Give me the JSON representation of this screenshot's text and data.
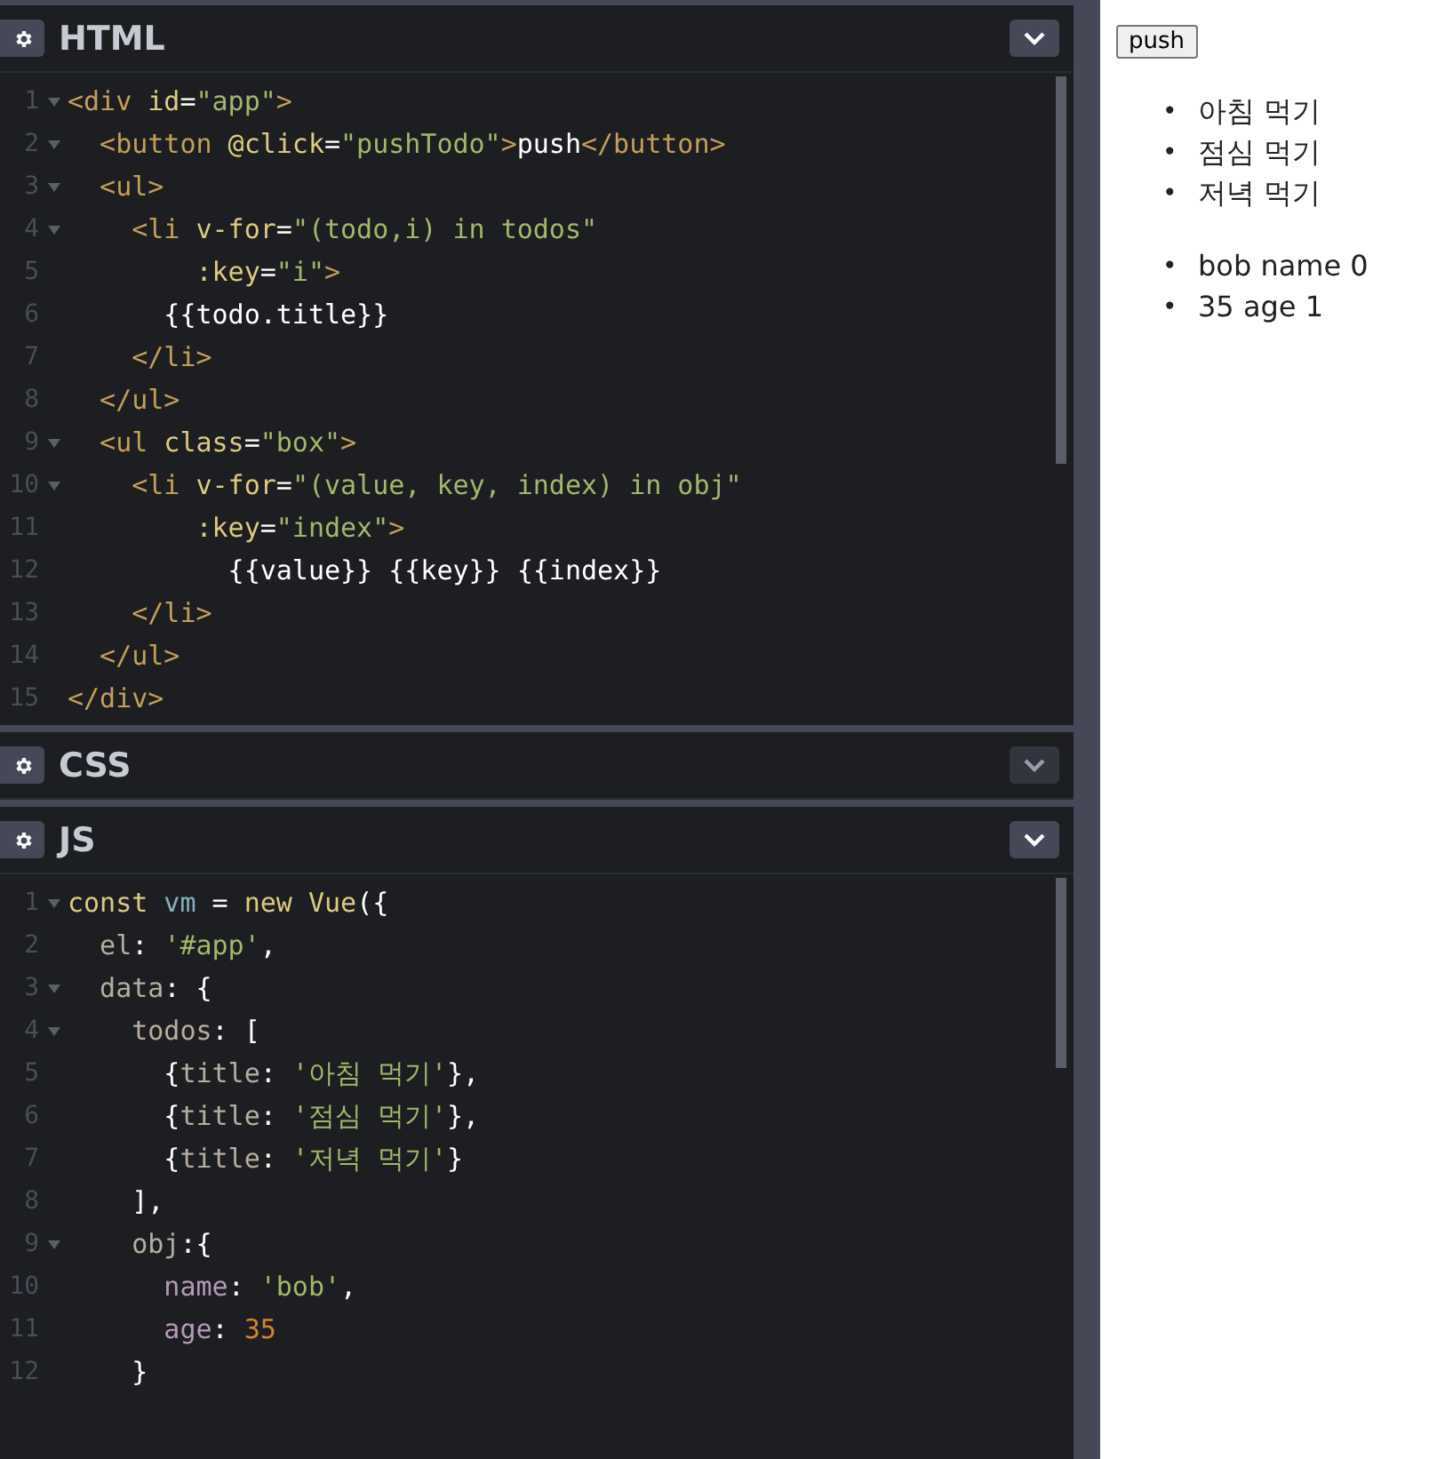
{
  "panels": [
    {
      "title": "HTML",
      "expanded": true,
      "lines": [
        {
          "number": "1",
          "foldable": true,
          "tokens": [
            {
              "kind": "tag",
              "text": "<div"
            },
            {
              "kind": "attr",
              "text": " id"
            },
            {
              "kind": "plain",
              "text": "="
            },
            {
              "kind": "string",
              "text": "\"app\""
            },
            {
              "kind": "tag",
              "text": ">"
            }
          ]
        },
        {
          "number": "2",
          "foldable": true,
          "tokens": [
            {
              "kind": "tag",
              "text": "  <button"
            },
            {
              "kind": "attr",
              "text": " @click"
            },
            {
              "kind": "plain",
              "text": "="
            },
            {
              "kind": "string",
              "text": "\"pushTodo\""
            },
            {
              "kind": "tag",
              "text": ">"
            },
            {
              "kind": "plain",
              "text": "push"
            },
            {
              "kind": "tag",
              "text": "</button>"
            }
          ]
        },
        {
          "number": "3",
          "foldable": true,
          "tokens": [
            {
              "kind": "tag",
              "text": "  <ul>"
            }
          ]
        },
        {
          "number": "4",
          "foldable": true,
          "tokens": [
            {
              "kind": "tag",
              "text": "    <li"
            },
            {
              "kind": "attr",
              "text": " v-for"
            },
            {
              "kind": "plain",
              "text": "="
            },
            {
              "kind": "string",
              "text": "\"(todo,i) in todos\""
            }
          ]
        },
        {
          "number": "5",
          "foldable": false,
          "tokens": [
            {
              "kind": "attr",
              "text": "        :key"
            },
            {
              "kind": "plain",
              "text": "="
            },
            {
              "kind": "string",
              "text": "\"i\""
            },
            {
              "kind": "tag",
              "text": ">"
            }
          ]
        },
        {
          "number": "6",
          "foldable": false,
          "tokens": [
            {
              "kind": "plain",
              "text": "      {{todo.title}}"
            }
          ]
        },
        {
          "number": "7",
          "foldable": false,
          "tokens": [
            {
              "kind": "tag",
              "text": "    </li>"
            }
          ]
        },
        {
          "number": "8",
          "foldable": false,
          "tokens": [
            {
              "kind": "tag",
              "text": "  </ul>"
            }
          ]
        },
        {
          "number": "9",
          "foldable": true,
          "tokens": [
            {
              "kind": "tag",
              "text": "  <ul"
            },
            {
              "kind": "attr",
              "text": " class"
            },
            {
              "kind": "plain",
              "text": "="
            },
            {
              "kind": "string",
              "text": "\"box\""
            },
            {
              "kind": "tag",
              "text": ">"
            }
          ]
        },
        {
          "number": "10",
          "foldable": true,
          "tokens": [
            {
              "kind": "tag",
              "text": "    <li"
            },
            {
              "kind": "attr",
              "text": " v-for"
            },
            {
              "kind": "plain",
              "text": "="
            },
            {
              "kind": "string",
              "text": "\"(value, key, index) in obj\""
            }
          ]
        },
        {
          "number": "11",
          "foldable": false,
          "tokens": [
            {
              "kind": "attr",
              "text": "        :key"
            },
            {
              "kind": "plain",
              "text": "="
            },
            {
              "kind": "string",
              "text": "\"index\""
            },
            {
              "kind": "tag",
              "text": ">"
            }
          ]
        },
        {
          "number": "12",
          "foldable": false,
          "tokens": [
            {
              "kind": "plain",
              "text": "          {{value}} {{key}} {{index}}"
            }
          ]
        },
        {
          "number": "13",
          "foldable": false,
          "tokens": [
            {
              "kind": "tag",
              "text": "    </li>"
            }
          ]
        },
        {
          "number": "14",
          "foldable": false,
          "tokens": [
            {
              "kind": "tag",
              "text": "  </ul>"
            }
          ]
        },
        {
          "number": "15",
          "foldable": false,
          "tokens": [
            {
              "kind": "tag",
              "text": "</div>"
            }
          ]
        }
      ]
    },
    {
      "title": "CSS",
      "expanded": false
    },
    {
      "title": "JS",
      "expanded": true,
      "lines": [
        {
          "number": "1",
          "foldable": true,
          "tokens": [
            {
              "kind": "keyword",
              "text": "const"
            },
            {
              "kind": "variable",
              "text": " vm"
            },
            {
              "kind": "plain",
              "text": " = "
            },
            {
              "kind": "keyword",
              "text": "new"
            },
            {
              "kind": "keyword",
              "text": " Vue"
            },
            {
              "kind": "plain",
              "text": "({"
            }
          ]
        },
        {
          "number": "2",
          "foldable": false,
          "tokens": [
            {
              "kind": "property",
              "text": "  el"
            },
            {
              "kind": "plain",
              "text": ": "
            },
            {
              "kind": "string",
              "text": "'#app'"
            },
            {
              "kind": "plain",
              "text": ","
            }
          ]
        },
        {
          "number": "3",
          "foldable": true,
          "tokens": [
            {
              "kind": "property",
              "text": "  data"
            },
            {
              "kind": "plain",
              "text": ": {"
            }
          ]
        },
        {
          "number": "4",
          "foldable": true,
          "tokens": [
            {
              "kind": "property",
              "text": "    todos"
            },
            {
              "kind": "plain",
              "text": ": ["
            }
          ]
        },
        {
          "number": "5",
          "foldable": false,
          "tokens": [
            {
              "kind": "plain",
              "text": "      {"
            },
            {
              "kind": "property",
              "text": "title"
            },
            {
              "kind": "plain",
              "text": ": "
            },
            {
              "kind": "string",
              "text": "'아침 먹기'"
            },
            {
              "kind": "plain",
              "text": "},"
            }
          ]
        },
        {
          "number": "6",
          "foldable": false,
          "tokens": [
            {
              "kind": "plain",
              "text": "      {"
            },
            {
              "kind": "property",
              "text": "title"
            },
            {
              "kind": "plain",
              "text": ": "
            },
            {
              "kind": "string",
              "text": "'점심 먹기'"
            },
            {
              "kind": "plain",
              "text": "},"
            }
          ]
        },
        {
          "number": "7",
          "foldable": false,
          "tokens": [
            {
              "kind": "plain",
              "text": "      {"
            },
            {
              "kind": "property",
              "text": "title"
            },
            {
              "kind": "plain",
              "text": ": "
            },
            {
              "kind": "string",
              "text": "'저녁 먹기'"
            },
            {
              "kind": "plain",
              "text": "}"
            }
          ]
        },
        {
          "number": "8",
          "foldable": false,
          "tokens": [
            {
              "kind": "plain",
              "text": "    ],"
            }
          ]
        },
        {
          "number": "9",
          "foldable": true,
          "tokens": [
            {
              "kind": "property",
              "text": "    obj"
            },
            {
              "kind": "plain",
              "text": ":{"
            }
          ]
        },
        {
          "number": "10",
          "foldable": false,
          "tokens": [
            {
              "kind": "key",
              "text": "      name"
            },
            {
              "kind": "plain",
              "text": ": "
            },
            {
              "kind": "string",
              "text": "'bob'"
            },
            {
              "kind": "plain",
              "text": ","
            }
          ]
        },
        {
          "number": "11",
          "foldable": false,
          "tokens": [
            {
              "kind": "key",
              "text": "      age"
            },
            {
              "kind": "plain",
              "text": ": "
            },
            {
              "kind": "number",
              "text": "35"
            }
          ]
        },
        {
          "number": "12",
          "foldable": false,
          "tokens": [
            {
              "kind": "plain",
              "text": "    }"
            }
          ]
        }
      ]
    }
  ],
  "preview": {
    "button": "push",
    "todos": [
      {
        "marker": "•",
        "text": "아침 먹기"
      },
      {
        "marker": "•",
        "text": "점심 먹기"
      },
      {
        "marker": "•",
        "text": "저녁 먹기"
      }
    ],
    "entries": [
      {
        "marker": "•",
        "text": "bob name 0"
      },
      {
        "marker": "•",
        "text": "35 age 1"
      }
    ]
  }
}
